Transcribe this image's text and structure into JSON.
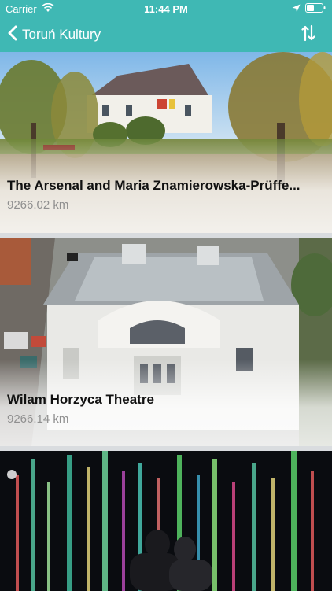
{
  "status": {
    "carrier": "Carrier",
    "time": "11:44 PM"
  },
  "nav": {
    "back_label": "Toruń Kultury"
  },
  "places": [
    {
      "name": "The Arsenal and Maria Znamierowska-Prüffe...",
      "distance": "9266.02 km"
    },
    {
      "name": "Wilam Horzyca Theatre",
      "distance": "9266.14 km"
    },
    {
      "name": "",
      "distance": ""
    }
  ],
  "colors": {
    "accent": "#3fb8b4",
    "title_text": "#111111",
    "distance_text": "#8f8f8f"
  },
  "icons": {
    "wifi": "wifi-icon",
    "location": "location-arrow-icon",
    "battery": "battery-icon",
    "back": "chevron-left-icon",
    "sort": "sort-arrows-icon"
  }
}
